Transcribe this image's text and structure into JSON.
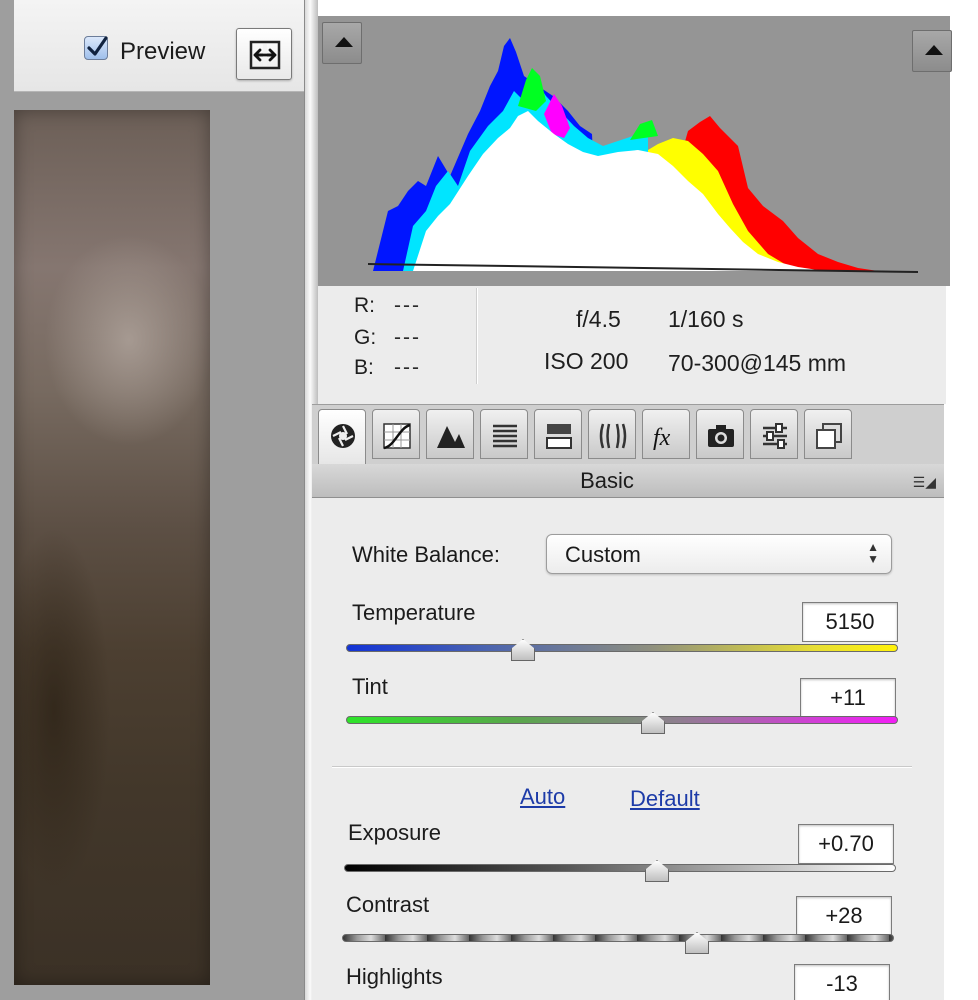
{
  "toolbar": {
    "preview_label": "Preview",
    "preview_checked": true,
    "swap_icon": "swap-arrows-icon"
  },
  "histogram": {
    "clip_warning_icon": "triangle-up-icon",
    "colors": {
      "blue": "#0015ff",
      "cyan": "#00e5ff",
      "green": "#00ff22",
      "magenta": "#ff00ff",
      "yellow": "#ffff00",
      "red": "#ff0000",
      "white": "#ffffff",
      "background": "#959595"
    }
  },
  "info": {
    "r_label": "R:",
    "r_value": "---",
    "g_label": "G:",
    "g_value": "---",
    "b_label": "B:",
    "b_value": "---",
    "aperture": "f/4.5",
    "shutter": "1/160 s",
    "iso": "ISO 200",
    "lens": "70-300@145 mm"
  },
  "tabs": [
    {
      "icon": "aperture-icon",
      "active": true
    },
    {
      "icon": "tone-curve-icon",
      "active": false
    },
    {
      "icon": "detail-icon",
      "active": false
    },
    {
      "icon": "hsl-icon",
      "active": false
    },
    {
      "icon": "split-toning-icon",
      "active": false
    },
    {
      "icon": "lens-corrections-icon",
      "active": false
    },
    {
      "icon": "effects-fx-icon",
      "active": false
    },
    {
      "icon": "camera-calibration-icon",
      "active": false
    },
    {
      "icon": "presets-icon",
      "active": false
    },
    {
      "icon": "snapshots-icon",
      "active": false
    }
  ],
  "panel": {
    "title": "Basic",
    "menu_icon": "panel-menu-icon",
    "white_balance_label": "White Balance:",
    "white_balance_value": "Custom",
    "auto_label": "Auto",
    "default_label": "Default",
    "temperature": {
      "label": "Temperature",
      "value": "5150",
      "position": 0.31
    },
    "tint": {
      "label": "Tint",
      "value": "+11",
      "position": 0.56
    },
    "exposure": {
      "label": "Exposure",
      "value": "+0.70",
      "position": 0.57
    },
    "contrast": {
      "label": "Contrast",
      "value": "+28",
      "position": 0.64
    },
    "highlights": {
      "label": "Highlights",
      "value": "-13"
    }
  }
}
